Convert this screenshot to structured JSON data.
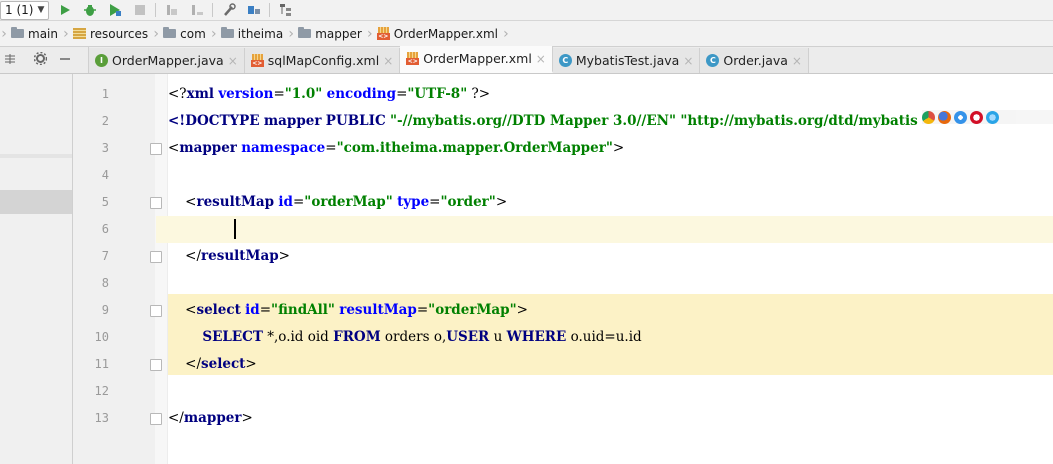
{
  "toolbar": {
    "run_config": "1 (1)",
    "buttons": [
      "run-icon",
      "debug-icon",
      "coverage-icon",
      "stop-icon",
      "build-icon",
      "deploy-icon",
      "wrench-icon",
      "structure-icon",
      "tree-icon"
    ]
  },
  "breadcrumb": {
    "items": [
      {
        "label": "main",
        "icon": "folder-icon"
      },
      {
        "label": "resources",
        "icon": "resources-folder-icon"
      },
      {
        "label": "com",
        "icon": "folder-icon"
      },
      {
        "label": "itheima",
        "icon": "folder-icon"
      },
      {
        "label": "mapper",
        "icon": "folder-icon"
      },
      {
        "label": "OrderMapper.xml",
        "icon": "xml-file-icon"
      }
    ]
  },
  "tabs": [
    {
      "label": "OrderMapper.java",
      "icon": "interface-icon",
      "icon_letter": "I",
      "color": "#5a9e3a",
      "active": false
    },
    {
      "label": "sqlMapConfig.xml",
      "icon": "xml-file-icon",
      "active": false
    },
    {
      "label": "OrderMapper.xml",
      "icon": "xml-file-icon",
      "active": true
    },
    {
      "label": "MybatisTest.java",
      "icon": "test-class-icon",
      "icon_letter": "C",
      "color": "#3d98c6",
      "active": false
    },
    {
      "label": "Order.java",
      "icon": "class-icon",
      "icon_letter": "C",
      "color": "#3d98c6",
      "active": false
    }
  ],
  "tab_close_glyph": "×",
  "code": {
    "lines": [
      {
        "n": "1",
        "text": "<?xml version=\"1.0\" encoding=\"UTF-8\" ?>"
      },
      {
        "n": "2",
        "text": "<!DOCTYPE mapper PUBLIC \"-//mybatis.org//DTD Mapper 3.0//EN\" \"http://mybatis.org/dtd/mybatis"
      },
      {
        "n": "3",
        "text": "<mapper namespace=\"com.itheima.mapper.OrderMapper\">"
      },
      {
        "n": "4",
        "text": ""
      },
      {
        "n": "5",
        "text": "    <resultMap id=\"orderMap\" type=\"order\">"
      },
      {
        "n": "6",
        "text": ""
      },
      {
        "n": "7",
        "text": "    </resultMap>"
      },
      {
        "n": "8",
        "text": ""
      },
      {
        "n": "9",
        "text": "    <select id=\"findAll\" resultMap=\"orderMap\">"
      },
      {
        "n": "10",
        "text": "        SELECT *,o.id oid FROM orders o,USER u WHERE o.uid=u.id"
      },
      {
        "n": "11",
        "text": "    </select>"
      },
      {
        "n": "12",
        "text": ""
      },
      {
        "n": "13",
        "text": "</mapper>"
      }
    ],
    "current_line": 6,
    "highlighted_lines": [
      9,
      10,
      11
    ]
  },
  "colors": {
    "tag": "#000080",
    "attribute": "#0000ff",
    "value": "#008000",
    "current_line_bg": "#fcf8df",
    "highlight_bg": "#fcf2c6"
  },
  "browser_icons": [
    "chrome-icon",
    "firefox-icon",
    "safari-icon",
    "opera-icon",
    "ie-icon"
  ]
}
